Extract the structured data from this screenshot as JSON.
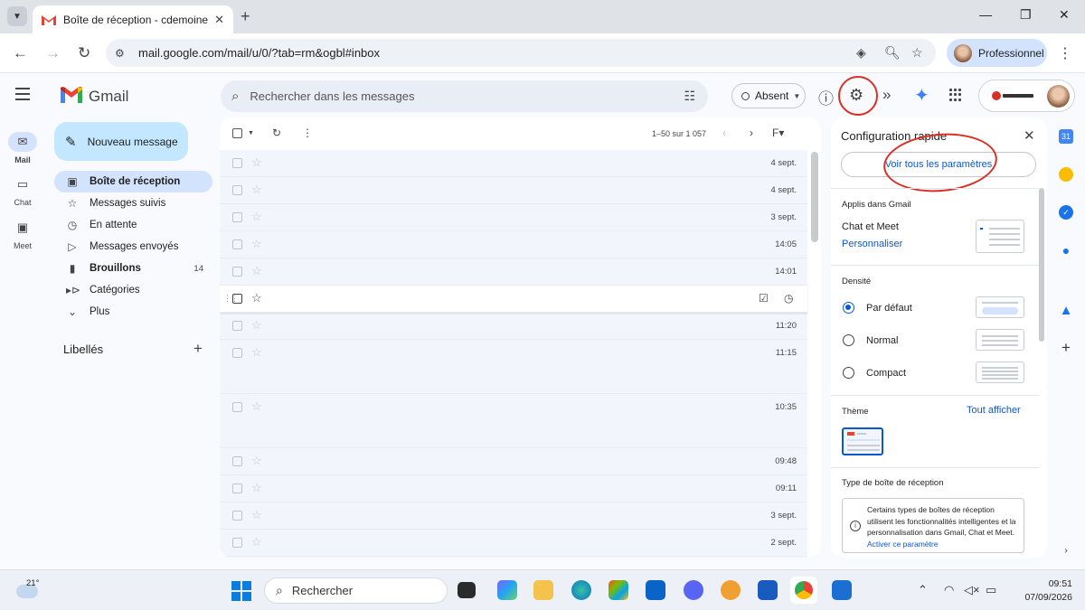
{
  "browser": {
    "tab_title": "Boîte de réception - cdemoiner",
    "url": "mail.google.com/mail/u/0/?tab=rm&ogbl#inbox",
    "profile_label": "Professionnel"
  },
  "gmail": {
    "app_name": "Gmail",
    "search_placeholder": "Rechercher dans les messages",
    "status_label": "Absent",
    "compose_label": "Nouveau message"
  },
  "rail": {
    "items": [
      {
        "label": "Mail",
        "icon": "mail-icon"
      },
      {
        "label": "Chat",
        "icon": "chat-icon"
      },
      {
        "label": "Meet",
        "icon": "video-icon"
      }
    ]
  },
  "sidebar": {
    "items": [
      {
        "label": "Boîte de réception",
        "icon": "inbox-icon",
        "count": ""
      },
      {
        "label": "Messages suivis",
        "icon": "star-icon",
        "count": ""
      },
      {
        "label": "En attente",
        "icon": "clock-icon",
        "count": ""
      },
      {
        "label": "Messages envoyés",
        "icon": "send-icon",
        "count": ""
      },
      {
        "label": "Brouillons",
        "icon": "draft-icon",
        "count": "14"
      },
      {
        "label": "Catégories",
        "icon": "label-icon",
        "count": ""
      },
      {
        "label": "Plus",
        "icon": "chevron-down-icon",
        "count": ""
      }
    ],
    "labels_title": "Libellés"
  },
  "mail_list": {
    "pagination": "1–50 sur 1 057",
    "rows": [
      {
        "time": "4 sept."
      },
      {
        "time": "4 sept."
      },
      {
        "time": "3 sept."
      },
      {
        "time": "14:05"
      },
      {
        "time": "14:01"
      },
      {
        "time": ""
      },
      {
        "time": "11:20"
      },
      {
        "time": "11:15"
      },
      {
        "time": "10:35"
      },
      {
        "time": "09:48"
      },
      {
        "time": "09:11"
      },
      {
        "time": "3 sept."
      },
      {
        "time": "2 sept."
      }
    ]
  },
  "quick_settings": {
    "title": "Configuration rapide",
    "see_all": "Voir tous les paramètres",
    "apps_heading": "Applis dans Gmail",
    "apps_text": "Chat et Meet",
    "apps_link": "Personnaliser",
    "density_heading": "Densité",
    "density_options": [
      "Par défaut",
      "Normal",
      "Compact"
    ],
    "density_selected": "Par défaut",
    "theme_heading": "Thème",
    "theme_link": "Tout afficher",
    "inbox_type_heading": "Type de boîte de réception",
    "info_text": "Certains types de boîtes de réception utilisent les fonctionnalités intelligentes et la personnalisation dans Gmail, Chat et Meet.",
    "info_link": "Activer ce paramètre"
  },
  "taskbar": {
    "temperature": "21°",
    "search_placeholder": "Rechercher",
    "time": "09:51",
    "date": "07/09/2026"
  },
  "colors": {
    "accent": "#0b57d0",
    "annotation": "#d93025",
    "compose_bg": "#c2e7ff",
    "selected_nav": "#d3e3fd"
  }
}
